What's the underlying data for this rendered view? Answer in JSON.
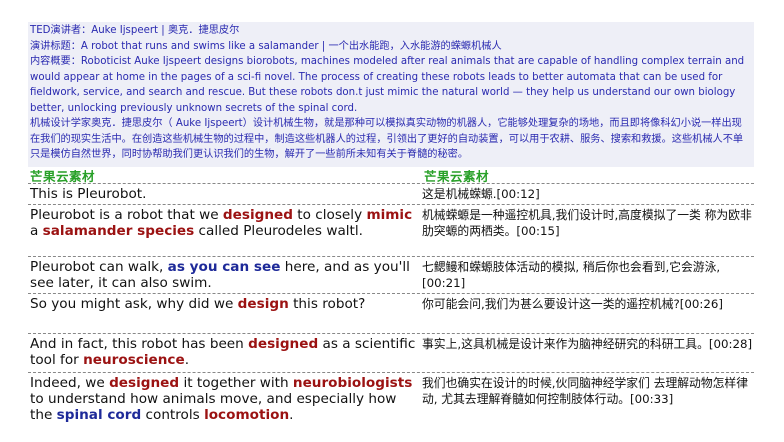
{
  "header": {
    "line1": "TED演讲者：Auke Ijspeert | 奥克．捷思皮尔",
    "line2": "演讲标题：A robot that runs and swims like a salamander | 一个出水能跑，入水能游的蝾螈机械人",
    "line3": "内容概要：Roboticist Auke Ijspeert designs biorobots, machines modeled after real animals that are capable of handling complex terrain and would appear at home in the pages of a sci-fi novel. The process of creating these robots leads to better automata that can be used for fieldwork, service, and search and rescue. But these robots don.t just mimic the natural world — they help us understand our own biology better, unlocking previously unknown secrets of the spinal cord.",
    "line4": "机械设计学家奥克．捷思皮尔（ Auke Ijspeert）设计机械生物，就是那种可以模拟真实动物的机器人，它能够处理复杂的场地，而且即将像科幻小说一样出现在我们的现实生活中。在创造这些机械生物的过程中，制造这些机器人的过程，引领出了更好的自动装置，可以用于农耕、服务、搜索和救援。这些机械人不单只是模仿自然世界，同时协帮助我们更认识我们的生物，解开了一些前所未知有关于脊髓的秘密。"
  },
  "brand": {
    "left": "芒果云素材",
    "right": "芒果云素材"
  },
  "rows": [
    {
      "en": [
        {
          "t": "This is Pleurobot."
        }
      ],
      "zh": "这是机械蝾螈.[00:12]"
    },
    {
      "en": [
        {
          "t": "Pleurobot is a robot that we "
        },
        {
          "t": "designed",
          "c": "red"
        },
        {
          "t": " to closely "
        },
        {
          "t": "mimic",
          "c": "red"
        },
        {
          "t": " a "
        },
        {
          "t": "salamander species",
          "c": "red"
        },
        {
          "t": " called Pleurodeles waltl."
        }
      ],
      "zh": "机械蝾螈是一种遥控机具,我们设计时,高度模拟了一类 称为欧非肋突螈的两栖类。[00:15]"
    },
    {
      "en": [
        {
          "t": "Pleurobot can walk, "
        },
        {
          "t": "as you can see",
          "c": "blue"
        },
        {
          "t": " here, and as you'll see later, it can also swim."
        }
      ],
      "zh": "七鳃鳗和蝾螈肢体活动的模拟, 稍后你也会看到,它会游泳,[00:21]"
    },
    {
      "en": [
        {
          "t": "So you might ask, why did we "
        },
        {
          "t": "design",
          "c": "red"
        },
        {
          "t": " this robot?"
        }
      ],
      "zh": "你可能会问,我们为甚么要设计这一类的遥控机械?[00:26]"
    },
    {
      "en": [
        {
          "t": "And in fact, this robot has been "
        },
        {
          "t": "designed",
          "c": "red"
        },
        {
          "t": " as a scientific tool for "
        },
        {
          "t": "neuroscience",
          "c": "red"
        },
        {
          "t": "."
        }
      ],
      "zh": "事实上,这具机械是设计来作为脑神经研究的科研工具。[00:28]"
    },
    {
      "en": [
        {
          "t": "Indeed, we "
        },
        {
          "t": "designed",
          "c": "red"
        },
        {
          "t": " it together with "
        },
        {
          "t": "neurobiologists",
          "c": "red"
        },
        {
          "t": " to understand how animals move, and especially how the "
        },
        {
          "t": "spinal cord",
          "c": "blue"
        },
        {
          "t": " controls "
        },
        {
          "t": "locomotion",
          "c": "red"
        },
        {
          "t": "."
        }
      ],
      "zh": "我们也确实在设计的时候,伙同脑神经学家们 去理解动物怎样律动, 尤其去理解脊髓如何控制肢体行动。[00:33]"
    }
  ]
}
